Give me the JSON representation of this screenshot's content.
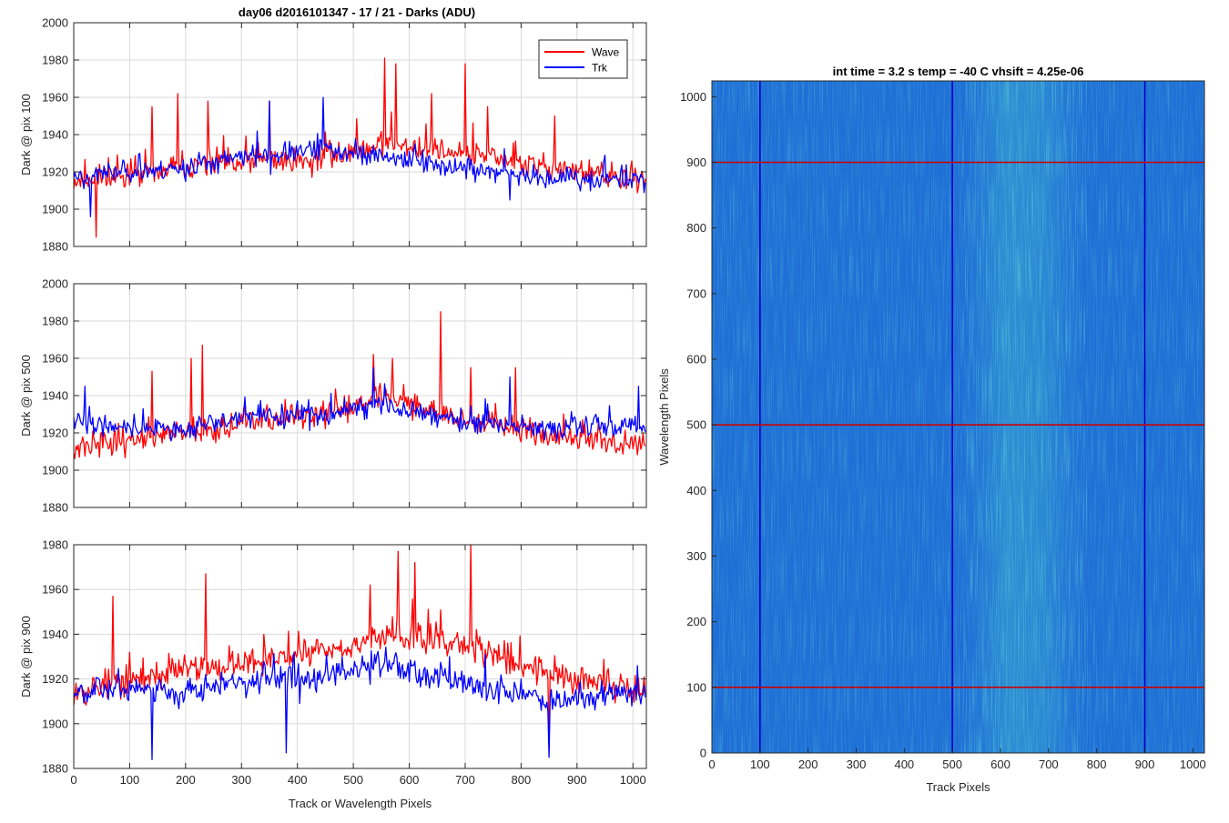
{
  "figure": {
    "title": "day06 d2016101347 - 17 / 21 - Darks (ADU)",
    "legend": {
      "placement": "top-right",
      "entries": [
        "Wave",
        "Trk"
      ]
    },
    "colors": {
      "wave": "#ff0000",
      "trk": "#0000ff",
      "grid": "#d9d9d9",
      "axis": "#262626"
    }
  },
  "chart_data": [
    {
      "type": "line",
      "ylabel": "Dark @ pix 100",
      "xlabel": "",
      "xlim": [
        0,
        1024
      ],
      "ylim": [
        1880,
        2000
      ],
      "xticks": [
        0,
        100,
        200,
        300,
        400,
        500,
        600,
        700,
        800,
        900,
        1000
      ],
      "yticks": [
        1880,
        1900,
        1920,
        1940,
        1960,
        1980,
        2000
      ],
      "grid": true,
      "series": [
        {
          "name": "Wave",
          "color": "#ff0000",
          "baseline": [
            [
              0,
              1915
            ],
            [
              150,
              1920
            ],
            [
              300,
              1925
            ],
            [
              450,
              1928
            ],
            [
              550,
              1935
            ],
            [
              700,
              1930
            ],
            [
              850,
              1922
            ],
            [
              1024,
              1915
            ]
          ],
          "noise": 10,
          "seed": 11,
          "peaks": [
            [
              40,
              1885
            ],
            [
              140,
              1955
            ],
            [
              185,
              1962
            ],
            [
              240,
              1958
            ],
            [
              350,
              1958
            ],
            [
              555,
              1981
            ],
            [
              575,
              1978
            ],
            [
              640,
              1962
            ],
            [
              700,
              1978
            ],
            [
              740,
              1955
            ],
            [
              860,
              1950
            ]
          ]
        },
        {
          "name": "Trk",
          "color": "#0000ff",
          "baseline": [
            [
              0,
              1918
            ],
            [
              200,
              1922
            ],
            [
              300,
              1928
            ],
            [
              450,
              1932
            ],
            [
              550,
              1928
            ],
            [
              700,
              1922
            ],
            [
              850,
              1916
            ],
            [
              1024,
              1916
            ]
          ],
          "noise": 8,
          "seed": 23,
          "peaks": [
            [
              30,
              1896
            ],
            [
              350,
              1958
            ],
            [
              445,
              1960
            ],
            [
              610,
              1935
            ],
            [
              780,
              1905
            ]
          ]
        }
      ]
    },
    {
      "type": "line",
      "ylabel": "Dark @ pix 500",
      "xlabel": "",
      "xlim": [
        0,
        1024
      ],
      "ylim": [
        1880,
        2000
      ],
      "xticks": [
        0,
        100,
        200,
        300,
        400,
        500,
        600,
        700,
        800,
        900,
        1000
      ],
      "yticks": [
        1880,
        1900,
        1920,
        1940,
        1960,
        1980,
        2000
      ],
      "grid": true,
      "series": [
        {
          "name": "Wave",
          "color": "#ff0000",
          "baseline": [
            [
              0,
              1912
            ],
            [
              150,
              1918
            ],
            [
              300,
              1925
            ],
            [
              450,
              1930
            ],
            [
              550,
              1940
            ],
            [
              700,
              1928
            ],
            [
              850,
              1918
            ],
            [
              1024,
              1915
            ]
          ],
          "noise": 10,
          "seed": 37,
          "peaks": [
            [
              140,
              1953
            ],
            [
              210,
              1960
            ],
            [
              230,
              1967
            ],
            [
              535,
              1962
            ],
            [
              570,
              1960
            ],
            [
              655,
              1985
            ],
            [
              710,
              1955
            ],
            [
              790,
              1955
            ]
          ]
        },
        {
          "name": "Trk",
          "color": "#0000ff",
          "baseline": [
            [
              0,
              1925
            ],
            [
              200,
              1922
            ],
            [
              300,
              1928
            ],
            [
              450,
              1930
            ],
            [
              550,
              1935
            ],
            [
              700,
              1925
            ],
            [
              850,
              1922
            ],
            [
              1024,
              1925
            ]
          ],
          "noise": 8,
          "seed": 41,
          "peaks": [
            [
              20,
              1945
            ],
            [
              535,
              1955
            ],
            [
              780,
              1950
            ],
            [
              1010,
              1945
            ]
          ]
        }
      ]
    },
    {
      "type": "line",
      "ylabel": "Dark @ pix 900",
      "xlabel": "Track or Wavelength Pixels",
      "xlim": [
        0,
        1024
      ],
      "ylim": [
        1880,
        1980
      ],
      "xticks": [
        0,
        100,
        200,
        300,
        400,
        500,
        600,
        700,
        800,
        900,
        1000
      ],
      "yticks": [
        1880,
        1900,
        1920,
        1940,
        1960,
        1980
      ],
      "grid": true,
      "series": [
        {
          "name": "Wave",
          "color": "#ff0000",
          "baseline": [
            [
              0,
              1915
            ],
            [
              150,
              1922
            ],
            [
              300,
              1928
            ],
            [
              450,
              1932
            ],
            [
              550,
              1940
            ],
            [
              700,
              1935
            ],
            [
              850,
              1922
            ],
            [
              1024,
              1915
            ]
          ],
          "noise": 10,
          "seed": 53,
          "peaks": [
            [
              70,
              1957
            ],
            [
              235,
              1967
            ],
            [
              530,
              1962
            ],
            [
              580,
              1977
            ],
            [
              610,
              1972
            ],
            [
              710,
              1980
            ],
            [
              850,
              1888
            ]
          ]
        },
        {
          "name": "Trk",
          "color": "#0000ff",
          "baseline": [
            [
              0,
              1915
            ],
            [
              200,
              1915
            ],
            [
              300,
              1918
            ],
            [
              450,
              1922
            ],
            [
              550,
              1928
            ],
            [
              700,
              1918
            ],
            [
              850,
              1910
            ],
            [
              1024,
              1915
            ]
          ],
          "noise": 8,
          "seed": 67,
          "peaks": [
            [
              140,
              1884
            ],
            [
              380,
              1887
            ],
            [
              850,
              1885
            ]
          ]
        }
      ]
    },
    {
      "type": "heatmap",
      "title": "int time = 3.2 s   temp = -40 C   vhsift = 4.25e-06",
      "xlabel": "Track Pixels",
      "ylabel": "Wavelength Pixels",
      "xlim": [
        0,
        1024
      ],
      "ylim": [
        0,
        1024
      ],
      "xticks": [
        0,
        100,
        200,
        300,
        400,
        500,
        600,
        700,
        800,
        900,
        1000
      ],
      "yticks": [
        0,
        100,
        200,
        300,
        400,
        500,
        600,
        700,
        800,
        900,
        1000
      ],
      "colors": {
        "low": "#1f6fd6",
        "mid": "#2a8fd8",
        "high": "#36c0b0"
      },
      "bright_band_x": [
        520,
        780
      ],
      "marker_lines": {
        "vertical": {
          "color": "#0000cc",
          "x": [
            100,
            500,
            900
          ]
        },
        "horizontal": {
          "color": "#cc0000",
          "y": [
            100,
            500,
            900
          ]
        }
      }
    }
  ]
}
